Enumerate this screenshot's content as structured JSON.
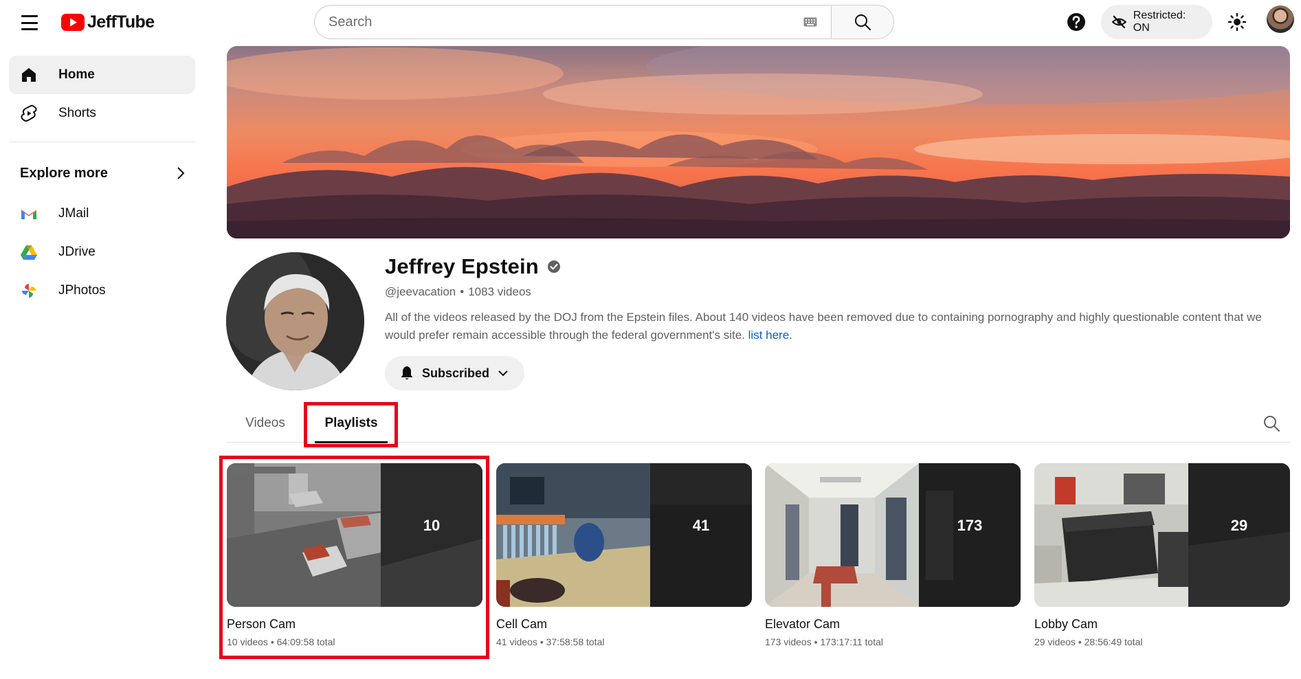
{
  "app": {
    "name": "JeffTube"
  },
  "search": {
    "placeholder": "Search"
  },
  "topbar": {
    "restricted_label": "Restricted: ON"
  },
  "sidebar": {
    "items": [
      {
        "label": "Home",
        "icon": "home-icon",
        "active": true
      },
      {
        "label": "Shorts",
        "icon": "shorts-icon",
        "active": false
      }
    ],
    "explore_header": "Explore more",
    "explore_items": [
      {
        "label": "JMail",
        "icon": "jmail-icon"
      },
      {
        "label": "JDrive",
        "icon": "jdrive-icon"
      },
      {
        "label": "JPhotos",
        "icon": "jphotos-icon"
      }
    ]
  },
  "channel": {
    "name": "Jeffrey Epstein",
    "handle": "@jeevacation",
    "separator": "•",
    "video_count": "1083 videos",
    "description": "All of the videos released by the DOJ from the Epstein files. About 140 videos have been removed due to containing pornography and highly questionable content that we would prefer remain accessible through the federal government's site. ",
    "description_link": "list here.",
    "subscribe_label": "Subscribed"
  },
  "tabs": [
    {
      "label": "Videos",
      "active": false
    },
    {
      "label": "Playlists",
      "active": true
    }
  ],
  "playlists": [
    {
      "title": "Person Cam",
      "count": "10",
      "meta": "10 videos • 64:09:58 total"
    },
    {
      "title": "Cell Cam",
      "count": "41",
      "meta": "41 videos • 37:58:58 total"
    },
    {
      "title": "Elevator Cam",
      "count": "173",
      "meta": "173 videos • 173:17:11 total"
    },
    {
      "title": "Lobby Cam",
      "count": "29",
      "meta": "29 videos • 28:56:49 total"
    }
  ],
  "colors": {
    "brand_red": "#ff0000",
    "highlight": "#e8001c",
    "link": "#065fd4",
    "text_secondary": "#606060"
  }
}
